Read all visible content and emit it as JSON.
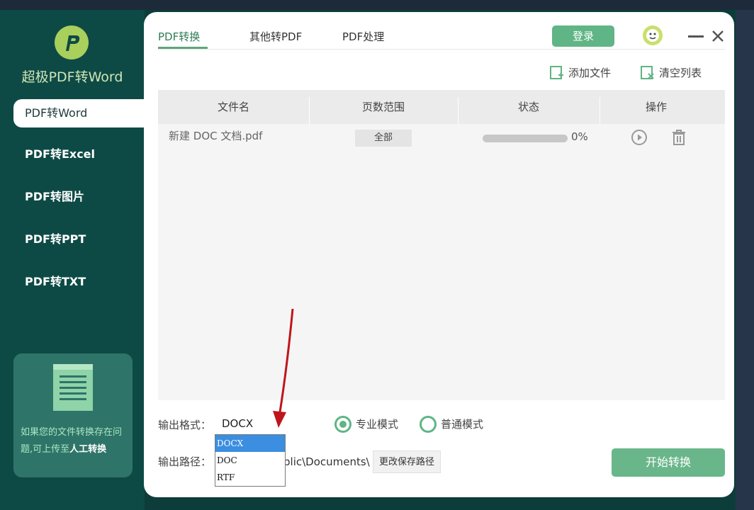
{
  "app": {
    "title": "超极PDF转Word"
  },
  "sidebar": {
    "items": [
      {
        "label": "PDF转Word",
        "active": true
      },
      {
        "label": "PDF转Excel"
      },
      {
        "label": "PDF转图片"
      },
      {
        "label": "PDF转PPT"
      },
      {
        "label": "PDF转TXT"
      }
    ],
    "help_text": "如果您的文件转换存在问题,可上传至",
    "help_link": "人工转换"
  },
  "tabs": [
    {
      "label": "PDF转换",
      "active": true
    },
    {
      "label": "其他转PDF"
    },
    {
      "label": "PDF处理"
    }
  ],
  "header": {
    "login_label": "登录"
  },
  "toolbar": {
    "add_file": "添加文件",
    "clear_list": "清空列表"
  },
  "table": {
    "columns": [
      "文件名",
      "页数范围",
      "状态",
      "操作"
    ],
    "rows": [
      {
        "filename": "新建 DOC 文档.pdf",
        "range": "全部",
        "progress": 0,
        "progress_text": "0%"
      }
    ]
  },
  "output": {
    "format_label": "输出格式：",
    "format_value": "DOCX",
    "format_options": [
      "DOCX",
      "DOC",
      "RTF"
    ],
    "mode_pro": "专业模式",
    "mode_normal": "普通模式",
    "path_label": "输出路径：",
    "path_value": "blic\\Documents\\",
    "change_path": "更改保存路径",
    "start_label": "开始转换"
  },
  "colors": {
    "sidebar": "#0e4a45",
    "accent": "#5fb585",
    "selected": "#3b8ee0",
    "annotation_arrow": "#c0141b"
  }
}
